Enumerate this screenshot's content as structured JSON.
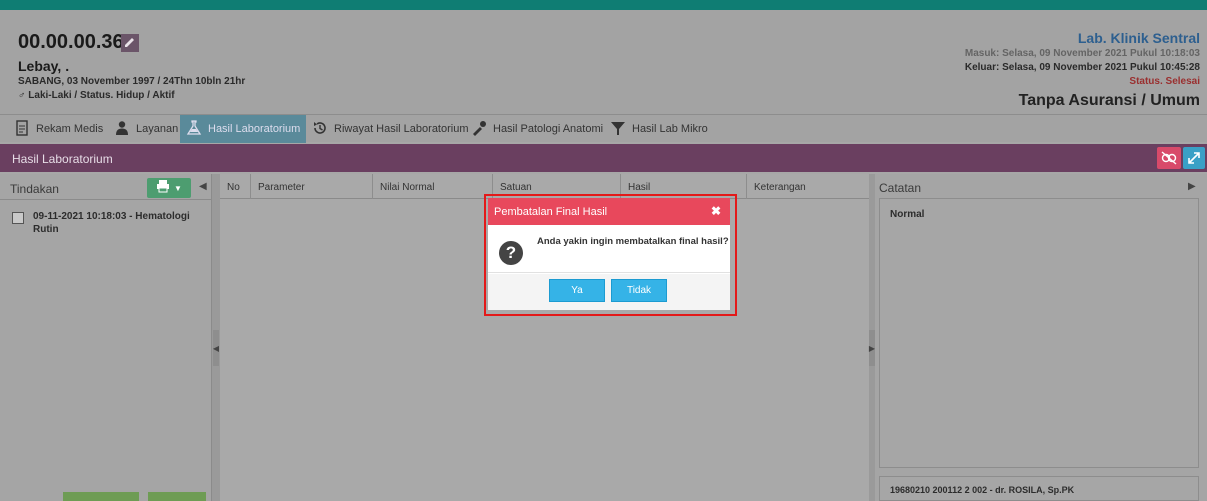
{
  "patient": {
    "id": "00.00.00.36",
    "name": "Lebay, .",
    "born": "SABANG, 03 November 1997 / 24Thn 10bln 21hr",
    "gender_status": "♂ Laki-Laki / Status. Hidup / Aktif"
  },
  "visit": {
    "unit": "Lab. Klinik Sentral",
    "masuk": "Masuk: Selasa, 09 November 2021 Pukul 10:18:03",
    "keluar": "Keluar: Selasa, 09 November 2021 Pukul 10:45:28",
    "status": "Status. Selesai",
    "insurance": "Tanpa Asuransi / Umum"
  },
  "tabs": [
    {
      "label": "Rekam Medis",
      "icon": "file-icon"
    },
    {
      "label": "Layanan",
      "icon": "doctor-icon"
    },
    {
      "label": "Hasil Laboratorium",
      "icon": "flask-icon",
      "active": true
    },
    {
      "label": "Riwayat Hasil Laboratorium",
      "icon": "history-icon"
    },
    {
      "label": "Hasil Patologi Anatomi",
      "icon": "pipette-icon"
    },
    {
      "label": "Hasil Lab Mikro",
      "icon": "filter-icon"
    }
  ],
  "section": {
    "title": "Hasil Laboratorium"
  },
  "left_panel": {
    "title": "Tindakan",
    "items": [
      {
        "label": "09-11-2021 10:18:03 - Hematologi Rutin"
      }
    ]
  },
  "grid": {
    "columns": [
      "No",
      "Parameter",
      "Nilai Normal",
      "Satuan",
      "Hasil",
      "Keterangan"
    ]
  },
  "right_panel": {
    "title": "Catatan",
    "note": "Normal",
    "signer": "19680210 200112 2 002 - dr. ROSILA, Sp.PK"
  },
  "modal": {
    "title": "Pembatalan Final Hasil",
    "message": "Anda yakin ingin membatalkan final hasil?",
    "yes": "Ya",
    "no": "Tidak"
  },
  "colors": {
    "topbar": "#0f7d73",
    "section_bar": "#6a3f60",
    "modal_header": "#e8485c",
    "modal_button": "#35b3e7",
    "highlight": "#e31919"
  }
}
